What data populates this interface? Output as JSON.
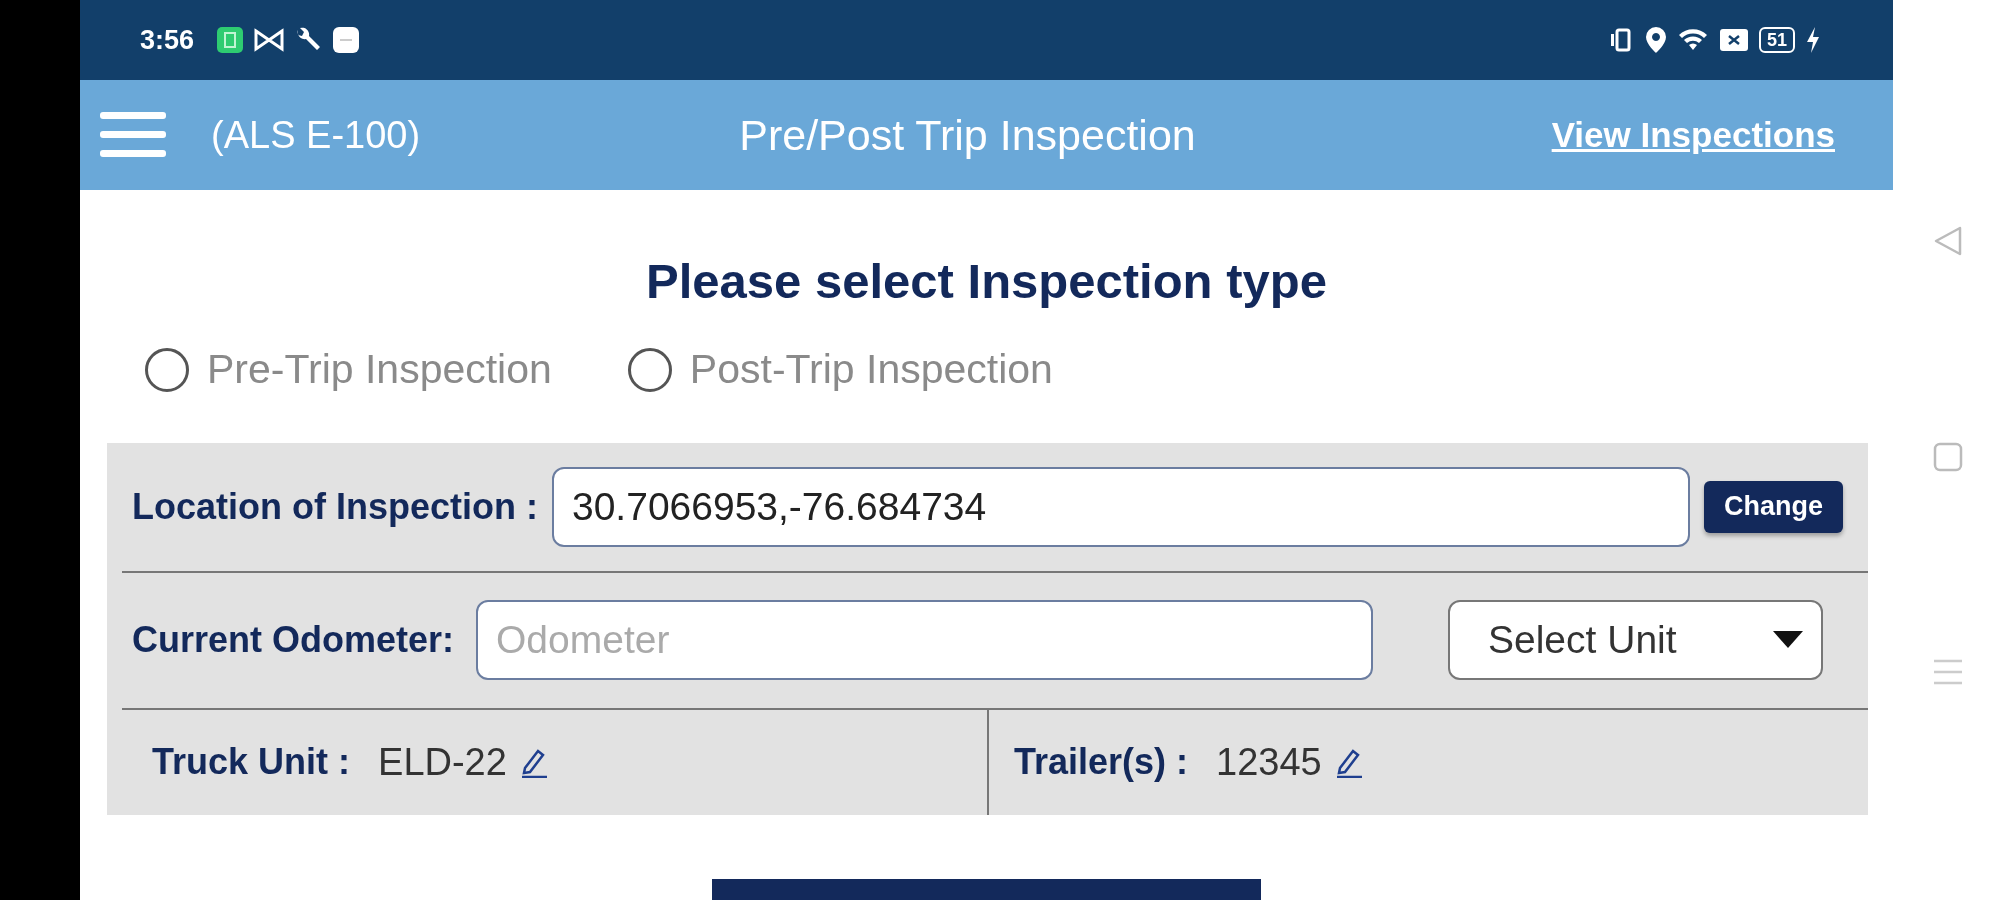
{
  "status_bar": {
    "time": "3:56",
    "battery": "51"
  },
  "header": {
    "unit": "(ALS E-100)",
    "title": "Pre/Post Trip Inspection",
    "link": "View Inspections"
  },
  "inspection_type": {
    "heading": "Please select Inspection type",
    "options": [
      {
        "label": "Pre-Trip Inspection",
        "selected": false
      },
      {
        "label": "Post-Trip Inspection",
        "selected": false
      }
    ]
  },
  "location": {
    "label": "Location of Inspection :",
    "value": "30.7066953,-76.684734",
    "button": "Change"
  },
  "odometer": {
    "label": "Current Odometer:",
    "placeholder": "Odometer",
    "unit_select": "Select Unit"
  },
  "truck": {
    "label": "Truck Unit :",
    "value": "ELD-22"
  },
  "trailer": {
    "label": "Trailer(s) :",
    "value": "12345"
  }
}
